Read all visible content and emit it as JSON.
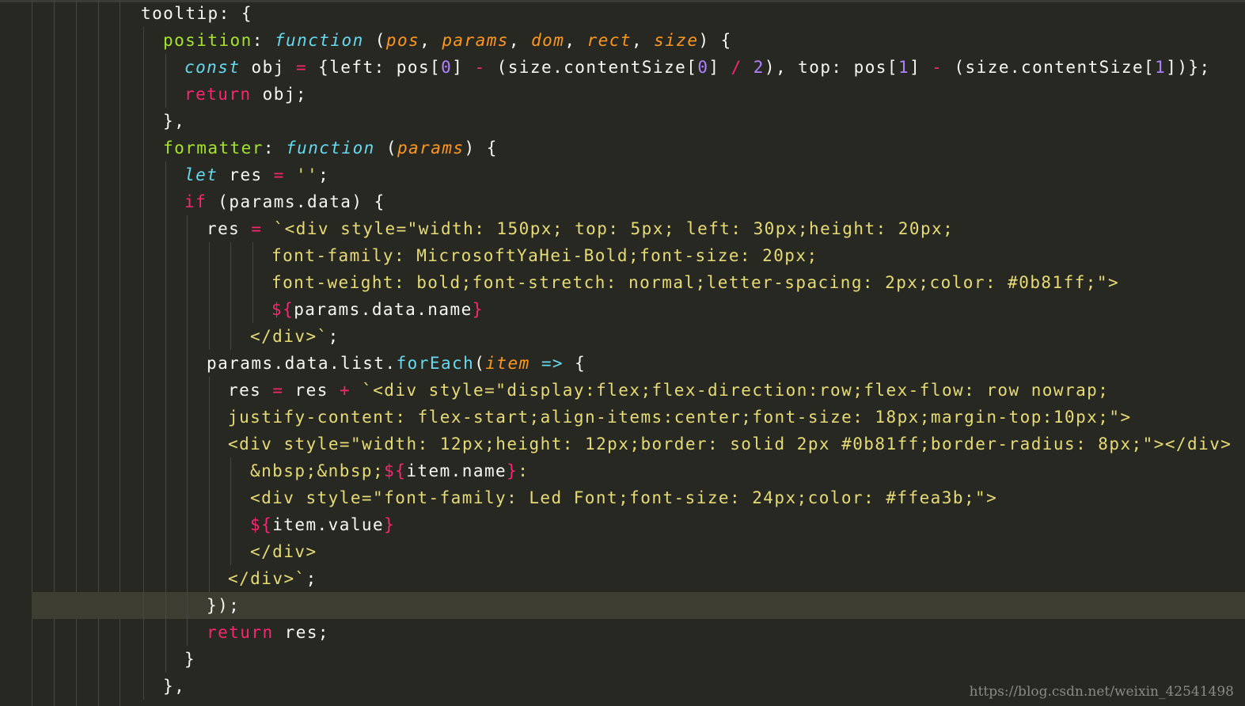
{
  "theme": {
    "background": "#272822",
    "foreground": "#f8f8f2",
    "keyword": "#f92672",
    "storage": "#66d9ef",
    "parameter": "#fd971f",
    "property": "#a6e22e",
    "string": "#e6db74",
    "number": "#ae81ff",
    "highlight_line": "#3e3d32"
  },
  "highlighted_line_index": 22,
  "code_lines": [
    {
      "indent": 0,
      "tokens": [
        {
          "t": "tooltip: {",
          "c": "p"
        }
      ]
    },
    {
      "indent": 1,
      "tokens": [
        {
          "t": "position",
          "c": "g"
        },
        {
          "t": ": ",
          "c": "p"
        },
        {
          "t": "function",
          "c": "f"
        },
        {
          "t": " (",
          "c": "p"
        },
        {
          "t": "pos",
          "c": "a"
        },
        {
          "t": ", ",
          "c": "p"
        },
        {
          "t": "params",
          "c": "a"
        },
        {
          "t": ", ",
          "c": "p"
        },
        {
          "t": "dom",
          "c": "a"
        },
        {
          "t": ", ",
          "c": "p"
        },
        {
          "t": "rect",
          "c": "a"
        },
        {
          "t": ", ",
          "c": "p"
        },
        {
          "t": "size",
          "c": "a"
        },
        {
          "t": ") {",
          "c": "p"
        }
      ]
    },
    {
      "indent": 2,
      "tokens": [
        {
          "t": "const",
          "c": "f"
        },
        {
          "t": " obj ",
          "c": "p"
        },
        {
          "t": "=",
          "c": "k"
        },
        {
          "t": " {left: pos[",
          "c": "p"
        },
        {
          "t": "0",
          "c": "n"
        },
        {
          "t": "] ",
          "c": "p"
        },
        {
          "t": "-",
          "c": "k"
        },
        {
          "t": " (size.contentSize[",
          "c": "p"
        },
        {
          "t": "0",
          "c": "n"
        },
        {
          "t": "] ",
          "c": "p"
        },
        {
          "t": "/",
          "c": "k"
        },
        {
          "t": " ",
          "c": "p"
        },
        {
          "t": "2",
          "c": "n"
        },
        {
          "t": "), top: pos[",
          "c": "p"
        },
        {
          "t": "1",
          "c": "n"
        },
        {
          "t": "] ",
          "c": "p"
        },
        {
          "t": "-",
          "c": "k"
        },
        {
          "t": " (size.contentSize[",
          "c": "p"
        },
        {
          "t": "1",
          "c": "n"
        },
        {
          "t": "])};",
          "c": "p"
        }
      ]
    },
    {
      "indent": 2,
      "tokens": [
        {
          "t": "return",
          "c": "k"
        },
        {
          "t": " obj;",
          "c": "p"
        }
      ]
    },
    {
      "indent": 1,
      "tokens": [
        {
          "t": "},",
          "c": "p"
        }
      ]
    },
    {
      "indent": 1,
      "tokens": [
        {
          "t": "formatter",
          "c": "g"
        },
        {
          "t": ": ",
          "c": "p"
        },
        {
          "t": "function",
          "c": "f"
        },
        {
          "t": " (",
          "c": "p"
        },
        {
          "t": "params",
          "c": "a"
        },
        {
          "t": ") {",
          "c": "p"
        }
      ]
    },
    {
      "indent": 2,
      "tokens": [
        {
          "t": "let",
          "c": "f"
        },
        {
          "t": " res ",
          "c": "p"
        },
        {
          "t": "=",
          "c": "k"
        },
        {
          "t": " ",
          "c": "p"
        },
        {
          "t": "''",
          "c": "s"
        },
        {
          "t": ";",
          "c": "p"
        }
      ]
    },
    {
      "indent": 2,
      "tokens": [
        {
          "t": "if",
          "c": "k"
        },
        {
          "t": " (params.data) {",
          "c": "p"
        }
      ]
    },
    {
      "indent": 3,
      "tokens": [
        {
          "t": "res ",
          "c": "p"
        },
        {
          "t": "=",
          "c": "k"
        },
        {
          "t": " ",
          "c": "p"
        },
        {
          "t": "`<div style=\"width: 150px; top: 5px; left: 30px;height: 20px;",
          "c": "s"
        }
      ]
    },
    {
      "indent": 6,
      "tokens": [
        {
          "t": "font-family: MicrosoftYaHei-Bold;font-size: 20px;",
          "c": "s"
        }
      ]
    },
    {
      "indent": 6,
      "tokens": [
        {
          "t": "font-weight: bold;font-stretch: normal;letter-spacing: 2px;color: #0b81ff;\">",
          "c": "s"
        }
      ]
    },
    {
      "indent": 6,
      "tokens": [
        {
          "t": "${",
          "c": "k"
        },
        {
          "t": "params.data.name",
          "c": "p"
        },
        {
          "t": "}",
          "c": "k"
        }
      ]
    },
    {
      "indent": 5,
      "tokens": [
        {
          "t": "</div>`",
          "c": "s"
        },
        {
          "t": ";",
          "c": "p"
        }
      ]
    },
    {
      "indent": 3,
      "tokens": [
        {
          "t": "params.data.list.",
          "c": "p"
        },
        {
          "t": "forEach",
          "c": "c"
        },
        {
          "t": "(",
          "c": "p"
        },
        {
          "t": "item",
          "c": "a"
        },
        {
          "t": " ",
          "c": "p"
        },
        {
          "t": "=>",
          "c": "f"
        },
        {
          "t": " {",
          "c": "p"
        }
      ]
    },
    {
      "indent": 4,
      "tokens": [
        {
          "t": "res ",
          "c": "p"
        },
        {
          "t": "=",
          "c": "k"
        },
        {
          "t": " res ",
          "c": "p"
        },
        {
          "t": "+",
          "c": "k"
        },
        {
          "t": " ",
          "c": "p"
        },
        {
          "t": "`<div style=\"display:flex;flex-direction:row;flex-flow: row nowrap;",
          "c": "s"
        }
      ]
    },
    {
      "indent": 4,
      "tokens": [
        {
          "t": "justify-content: flex-start;align-items:center;font-size: 18px;margin-top:10px;\">",
          "c": "s"
        }
      ]
    },
    {
      "indent": 4,
      "tokens": [
        {
          "t": "<div style=\"width: 12px;height: 12px;border: solid 2px #0b81ff;border-radius: 8px;\"></div>",
          "c": "s"
        }
      ]
    },
    {
      "indent": 5,
      "tokens": [
        {
          "t": "&nbsp;&nbsp;",
          "c": "s"
        },
        {
          "t": "${",
          "c": "k"
        },
        {
          "t": "item.name",
          "c": "p"
        },
        {
          "t": "}",
          "c": "k"
        },
        {
          "t": ":",
          "c": "s"
        }
      ]
    },
    {
      "indent": 5,
      "tokens": [
        {
          "t": "<div style=\"font-family: Led Font;font-size: 24px;color: #ffea3b;\">",
          "c": "s"
        }
      ]
    },
    {
      "indent": 5,
      "tokens": [
        {
          "t": "${",
          "c": "k"
        },
        {
          "t": "item.value",
          "c": "p"
        },
        {
          "t": "}",
          "c": "k"
        }
      ]
    },
    {
      "indent": 5,
      "tokens": [
        {
          "t": "</div>",
          "c": "s"
        }
      ]
    },
    {
      "indent": 4,
      "tokens": [
        {
          "t": "</div>`",
          "c": "s"
        },
        {
          "t": ";",
          "c": "p"
        }
      ]
    },
    {
      "indent": 3,
      "tokens": [
        {
          "t": "});",
          "c": "p"
        }
      ]
    },
    {
      "indent": 3,
      "tokens": [
        {
          "t": "return",
          "c": "k"
        },
        {
          "t": " res;",
          "c": "p"
        }
      ]
    },
    {
      "indent": 2,
      "tokens": [
        {
          "t": "}",
          "c": "p"
        }
      ]
    },
    {
      "indent": 1,
      "tokens": [
        {
          "t": "},",
          "c": "p"
        }
      ]
    }
  ],
  "watermark": "https://blog.csdn.net/weixin_42541498"
}
